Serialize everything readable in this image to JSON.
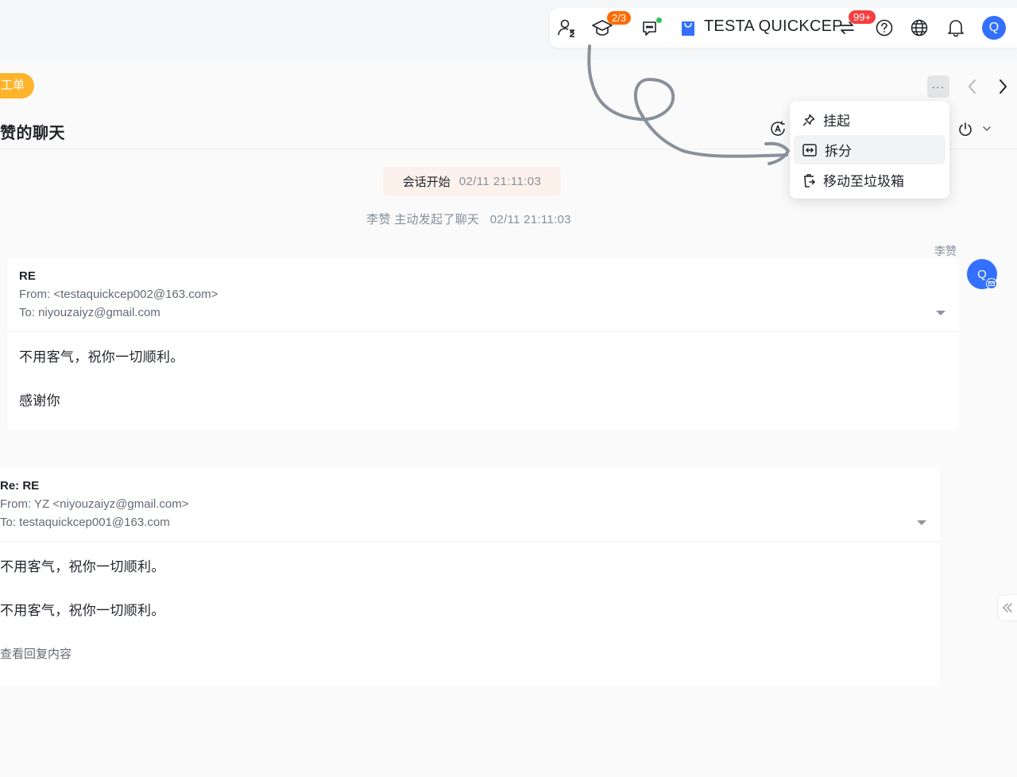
{
  "topbar": {
    "learning_badge": "2/3",
    "account_name": "TESTA QUICKCEP",
    "notification_badge": "99+",
    "user_avatar_initial": "Q",
    "icons": [
      "agent-status-icon",
      "learning-cap-icon",
      "chat-message-icon",
      "store-bag-icon",
      "switch-account-icon",
      "help-icon",
      "globe-icon",
      "bell-icon"
    ]
  },
  "conversation": {
    "ticket_tag": "工单",
    "title": "赞的聊天",
    "more_label": "···"
  },
  "menu": {
    "items": [
      {
        "label": "挂起",
        "icon": "pin-icon"
      },
      {
        "label": "拆分",
        "icon": "split-icon"
      },
      {
        "label": "移动至垃圾箱",
        "icon": "trash-move-icon"
      }
    ]
  },
  "timeline": {
    "session_start_label": "会话开始",
    "session_start_time": "02/11 21:11:03",
    "system_message": "李赞 主动发起了聊天",
    "system_message_time": "02/11 21:11:03",
    "sender_name": "李赞",
    "sender_avatar_initial": "Q"
  },
  "emails": [
    {
      "subject": "RE",
      "from": "From: <testaquickcep002@163.com>",
      "to": "To: niyouzaiyz@gmail.com",
      "body": [
        "不用客气，祝你一切顺利。",
        "感谢你"
      ]
    },
    {
      "subject": "Re: RE",
      "from": "From: YZ <niyouzaiyz@gmail.com>",
      "to": "To: testaquickcep001@163.com",
      "body": [
        "不用客气，祝你一切顺利。",
        "不用客气，祝你一切顺利。"
      ],
      "view_reply_label": "查看回复内容"
    }
  ],
  "colors": {
    "accent": "#3370ff",
    "ticket_tag": "#ffb42b",
    "badge_orange": "#ff6a00",
    "badge_red": "#f53f3f",
    "online": "#2fc25b",
    "annotation_stroke": "#8a9099"
  }
}
